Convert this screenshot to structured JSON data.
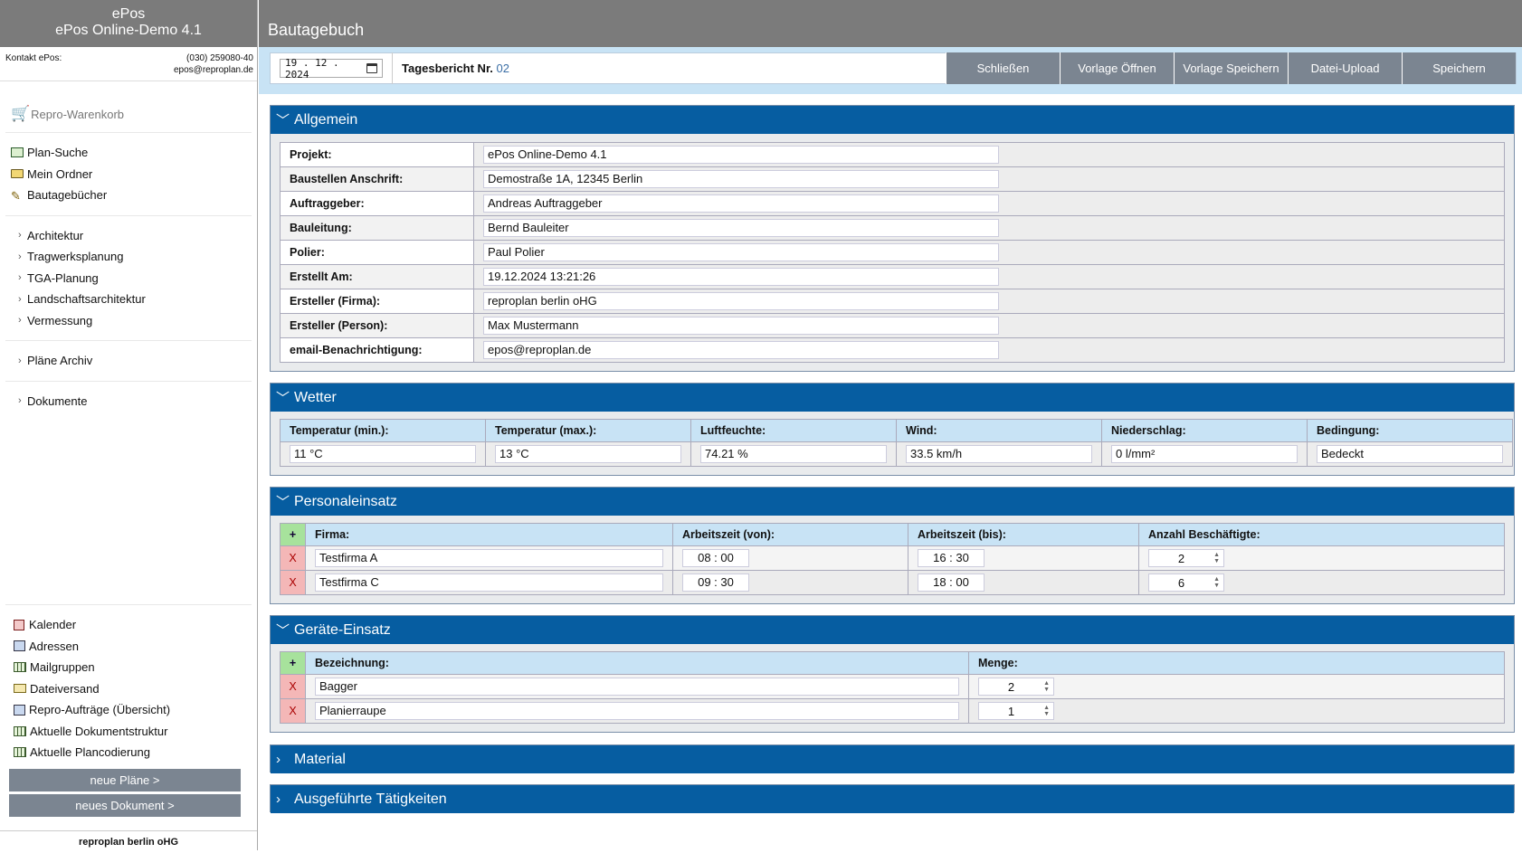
{
  "sidebar": {
    "brand_line1": "ePos",
    "brand_line2": "ePos Online-Demo 4.1",
    "contact_label": "Kontakt ePos:",
    "contact_phone": "(030) 259080-40",
    "contact_email": "epos@reproplan.de",
    "cart_label": "Repro-Warenkorb",
    "main_items": [
      "Plan-Suche",
      "Mein Ordner",
      "Bautagebücher"
    ],
    "category_items": [
      "Architektur",
      "Tragwerksplanung",
      "TGA-Planung",
      "Landschaftsarchitektur",
      "Vermessung"
    ],
    "archive_item": "Pläne Archiv",
    "documents_item": "Dokumente",
    "bottom_items": [
      "Kalender",
      "Adressen",
      "Mailgruppen",
      "Dateiversand",
      "Repro-Aufträge (Übersicht)",
      "Aktuelle Dokumentstruktur",
      "Aktuelle Plancodierung"
    ],
    "btn_new_plans": "neue Pläne >",
    "btn_new_document": "neues Dokument >",
    "footer": "reproplan berlin oHG"
  },
  "header": {
    "title": "Bautagebuch"
  },
  "toolbar": {
    "date_value": "19 . 12 . 2024",
    "report_label": "Tagesbericht Nr.",
    "report_number": "02",
    "buttons": [
      "Schließen",
      "Vorlage Öffnen",
      "Vorlage Speichern",
      "Datei-Upload",
      "Speichern"
    ]
  },
  "allgemein": {
    "title": "Allgemein",
    "rows": [
      {
        "label": "Projekt:",
        "value": "ePos Online-Demo 4.1"
      },
      {
        "label": "Baustellen Anschrift:",
        "value": "Demostraße 1A, 12345 Berlin"
      },
      {
        "label": "Auftraggeber:",
        "value": "Andreas Auftraggeber"
      },
      {
        "label": "Bauleitung:",
        "value": "Bernd Bauleiter"
      },
      {
        "label": "Polier:",
        "value": "Paul Polier"
      },
      {
        "label": "Erstellt Am:",
        "value": "19.12.2024 13:21:26"
      },
      {
        "label": "Ersteller (Firma):",
        "value": "reproplan berlin oHG"
      },
      {
        "label": "Ersteller (Person):",
        "value": "Max Mustermann"
      },
      {
        "label": "email-Benachrichtigung:",
        "value": "epos@reproplan.de"
      }
    ]
  },
  "wetter": {
    "title": "Wetter",
    "headers": [
      "Temperatur (min.):",
      "Temperatur (max.):",
      "Luftfeuchte:",
      "Wind:",
      "Niederschlag:",
      "Bedingung:"
    ],
    "values": [
      "11 °C",
      "13 °C",
      "74.21 %",
      "33.5 km/h",
      "0 l/mm²",
      "Bedeckt"
    ]
  },
  "personal": {
    "title": "Personaleinsatz",
    "add_symbol": "+",
    "delete_symbol": "X",
    "headers": [
      "Firma:",
      "Arbeitszeit (von):",
      "Arbeitszeit (bis):",
      "Anzahl Beschäftigte:"
    ],
    "rows": [
      {
        "firma": "Testfirma A",
        "von": "08 : 00",
        "bis": "16 : 30",
        "anzahl": "2"
      },
      {
        "firma": "Testfirma C",
        "von": "09 : 30",
        "bis": "18 : 00",
        "anzahl": "6"
      }
    ]
  },
  "geraete": {
    "title": "Geräte-Einsatz",
    "headers": [
      "Bezeichnung:",
      "Menge:"
    ],
    "rows": [
      {
        "name": "Bagger",
        "menge": "2"
      },
      {
        "name": "Planierraupe",
        "menge": "1"
      }
    ]
  },
  "material": {
    "title": "Material"
  },
  "taetigkeiten": {
    "title": "Ausgeführte Tätigkeiten"
  },
  "colors": {
    "panel_header": "#065da1",
    "sidebar_gray": "#7b7b7b",
    "button_gray": "#7b8591",
    "light_blue": "#c8e3f5",
    "add_green": "#a7e29c",
    "delete_red": "#f4b7b7"
  }
}
